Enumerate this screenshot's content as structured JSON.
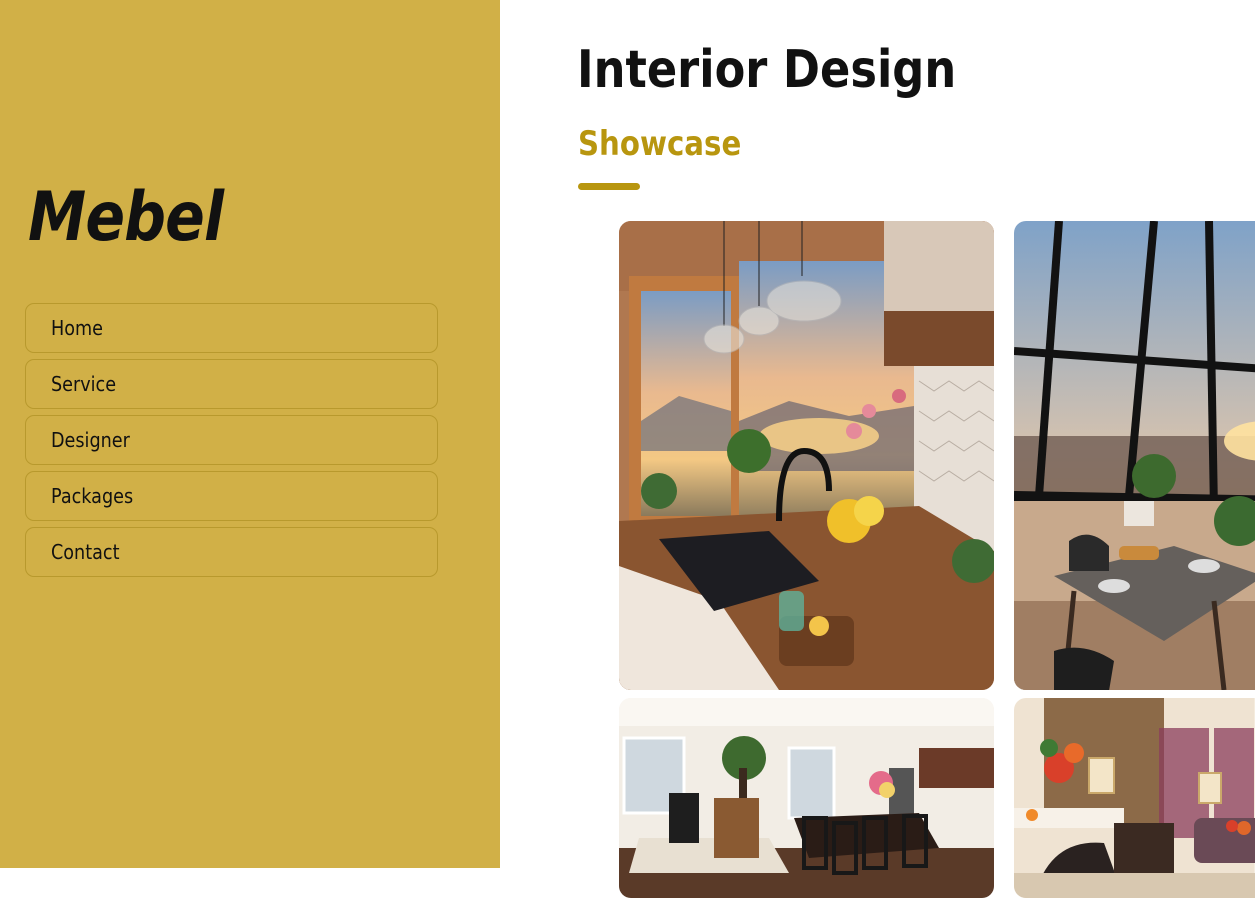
{
  "brand": {
    "logo": "Mebel"
  },
  "nav": {
    "items": [
      {
        "label": "Home"
      },
      {
        "label": "Service"
      },
      {
        "label": "Designer"
      },
      {
        "label": "Packages"
      },
      {
        "label": "Contact"
      }
    ]
  },
  "header": {
    "title": "Interior Design",
    "subtitle": "Showcase"
  },
  "gallery": {
    "images": [
      {
        "name": "kitchen-sunset-photo"
      },
      {
        "name": "dining-window-sunset-photo"
      },
      {
        "name": "open-plan-dining-photo"
      },
      {
        "name": "living-room-flowers-photo"
      }
    ]
  },
  "colors": {
    "sidebar": "#d1b047",
    "accent": "#b8960f",
    "text": "#111111",
    "background": "#ffffff"
  }
}
